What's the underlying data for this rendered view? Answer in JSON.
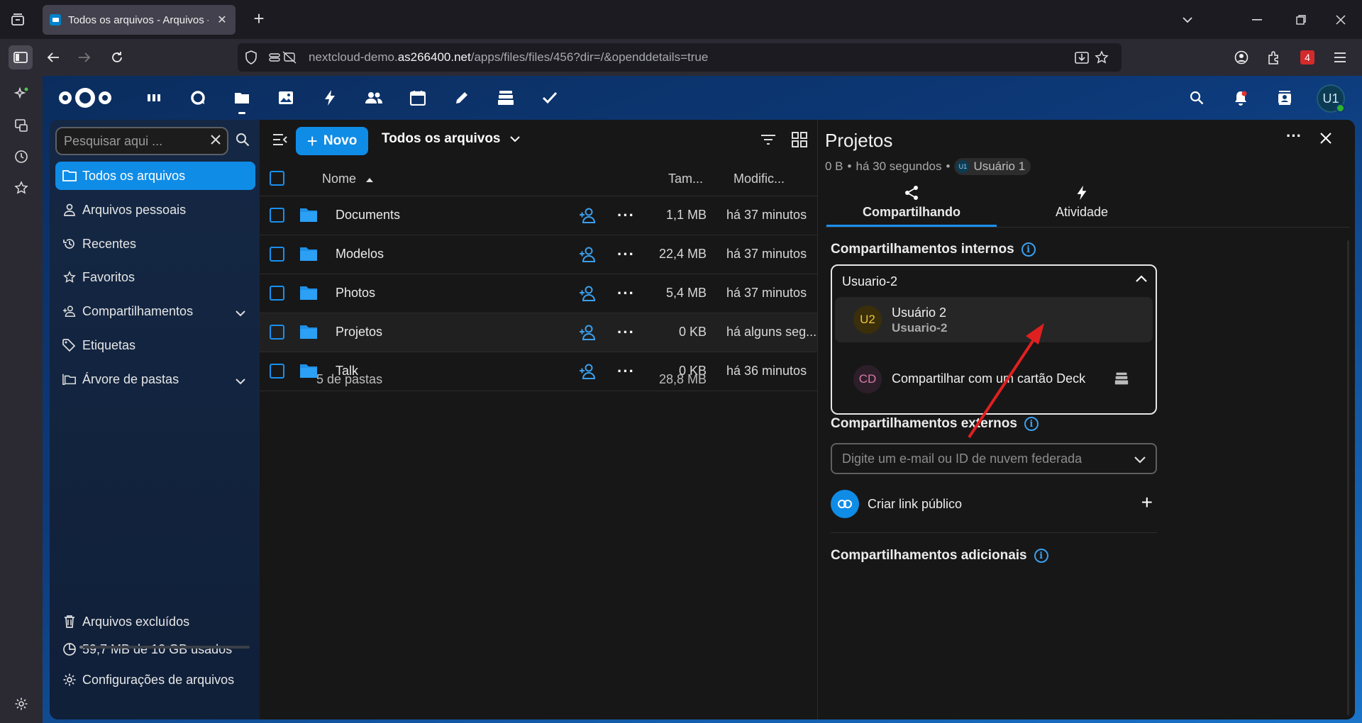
{
  "browser": {
    "tab_title": "Todos os arquivos - Arquivos - N",
    "url_prefix": "nextcloud-demo.",
    "url_host": "as266400.net",
    "url_path": "/apps/files/files/456?dir=/&openddetails=true",
    "extension_badge": "4"
  },
  "header": {
    "apps": [
      "dashboard-icon",
      "talk-icon",
      "files-icon",
      "photos-icon",
      "activity-icon",
      "contacts-icon",
      "calendar-icon",
      "notes-icon",
      "deck-icon",
      "tasks-icon"
    ],
    "user_avatar": "U1"
  },
  "nav": {
    "search_placeholder": "Pesquisar aqui ...",
    "items": [
      {
        "label": "Todos os arquivos",
        "icon": "folder-icon"
      },
      {
        "label": "Arquivos pessoais",
        "icon": "person-icon"
      },
      {
        "label": "Recentes",
        "icon": "history-icon"
      },
      {
        "label": "Favoritos",
        "icon": "star-icon"
      },
      {
        "label": "Compartilhamentos",
        "icon": "share-icon"
      },
      {
        "label": "Etiquetas",
        "icon": "tag-icon"
      },
      {
        "label": "Árvore de pastas",
        "icon": "folder-tree-icon"
      }
    ],
    "trash_label": "Arquivos excluídos",
    "quota_label": "59,7 MB de 10 GB usados",
    "quota_fraction": 0.006,
    "settings_label": "Configurações de arquivos"
  },
  "files": {
    "new_button": "Novo",
    "breadcrumb": "Todos os arquivos",
    "columns": {
      "name": "Nome",
      "size": "Tam...",
      "modified": "Modific..."
    },
    "rows": [
      {
        "name": "Documents",
        "size": "1,1 MB",
        "modified": "há 37 minutos"
      },
      {
        "name": "Modelos",
        "size": "22,4 MB",
        "modified": "há 37 minutos"
      },
      {
        "name": "Photos",
        "size": "5,4 MB",
        "modified": "há 37 minutos"
      },
      {
        "name": "Projetos",
        "size": "0 KB",
        "modified": "há alguns seg..."
      },
      {
        "name": "Talk",
        "size": "0 KB",
        "modified": "há 36 minutos"
      }
    ],
    "summary_count": "5 de pastas",
    "summary_size": "28,8 MB"
  },
  "sidebar": {
    "title": "Projetos",
    "size": "0 B",
    "time": "há 30 segundos",
    "owner_avatar": "U1",
    "owner_name": "Usuário 1",
    "tabs": [
      {
        "label": "Compartilhando",
        "icon": "share-icon"
      },
      {
        "label": "Atividade",
        "icon": "activity-icon"
      }
    ],
    "internal_title": "Compartilhamentos internos",
    "search_value": "Usuario-2",
    "options": [
      {
        "avatar": "U2",
        "name": "Usuário 2",
        "sub": "Usuario-2"
      },
      {
        "avatar": "CD",
        "name": "Compartilhar com um cartão Deck",
        "sub": ""
      }
    ],
    "external_title": "Compartilhamentos externos",
    "external_placeholder": "Digite um e-mail ou ID de nuvem federada",
    "public_link_label": "Criar link público",
    "additional_title": "Compartilhamentos adicionais"
  },
  "colors": {
    "accent": "#0f8ce6",
    "annotation_arrow": "#e02020"
  }
}
